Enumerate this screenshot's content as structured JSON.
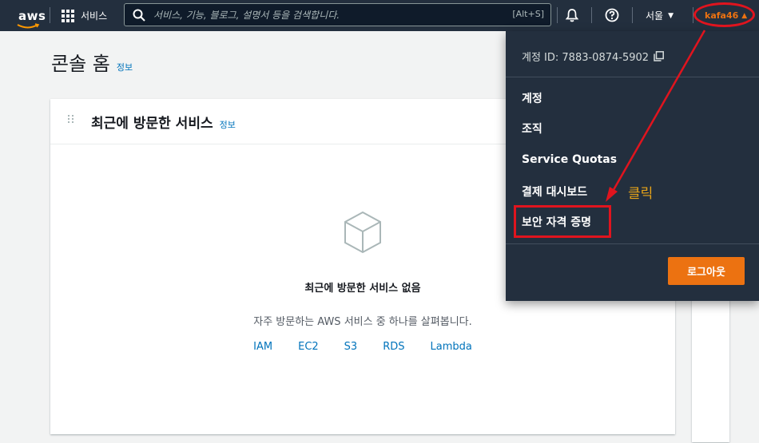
{
  "nav": {
    "logo_text": "aws",
    "services_label": "서비스",
    "search_placeholder": "서비스, 기능, 블로그, 설명서 등을 검색합니다.",
    "search_shortcut": "[Alt+S]",
    "region_label": "서울",
    "account_label": "kafa46"
  },
  "page": {
    "title": "콘솔 홈",
    "info_link": "정보"
  },
  "recent_card": {
    "title": "최근에 방문한 서비스",
    "info_link": "정보",
    "empty_title": "최근에 방문한 서비스 없음",
    "empty_subtitle": "자주 방문하는 AWS 서비스 중 하나를 살펴봅니다.",
    "quick_links": [
      "IAM",
      "EC2",
      "S3",
      "RDS",
      "Lambda"
    ]
  },
  "account_menu": {
    "account_id": "계정 ID: 7883-0874-5902",
    "items": [
      "계정",
      "조직",
      "Service Quotas",
      "결제 대시보드",
      "보안 자격 증명"
    ],
    "logout_label": "로그아웃"
  },
  "annotation": {
    "click_label": "클릭"
  },
  "colors": {
    "nav_bg": "#232f3e",
    "accent_orange": "#ec7211",
    "link_blue": "#0073bb",
    "annotation_red": "#e0141e",
    "annotation_label": "#e8a418"
  },
  "icons": [
    "search-icon",
    "grid-icon",
    "bell-icon",
    "help-icon",
    "copy-icon",
    "cube-icon",
    "drag-handle-icon"
  ]
}
